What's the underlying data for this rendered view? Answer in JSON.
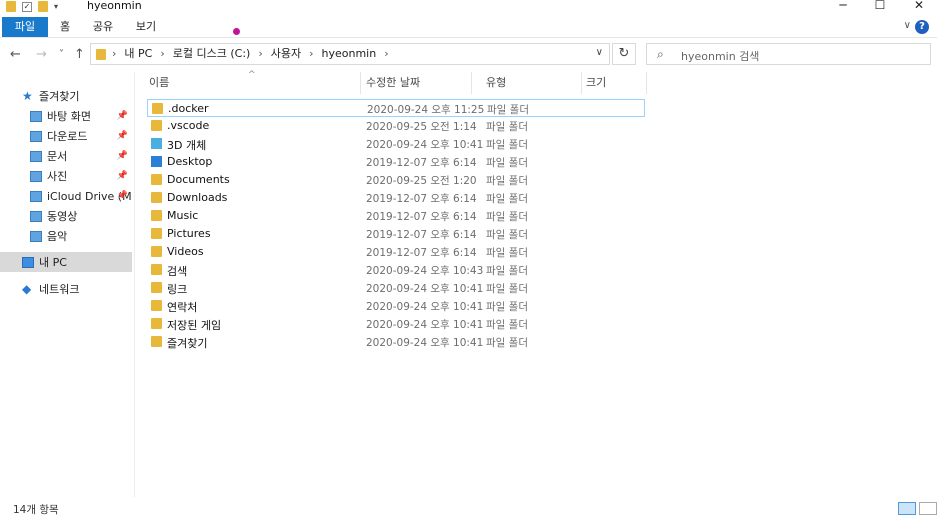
{
  "window": {
    "title": "hyeonmin",
    "buttons": [
      "─",
      "☐",
      "✕"
    ]
  },
  "ribbon": {
    "tabs": [
      "파일",
      "홈",
      "공유",
      "보기"
    ],
    "help": "?",
    "collapse": "∨"
  },
  "nav": {
    "back": "←",
    "forward": "→",
    "recent": "˅",
    "up": "↑"
  },
  "address": {
    "crumbs": [
      "내 PC",
      "로컬 디스크 (C:)",
      "사용자",
      "hyeonmin"
    ],
    "separator": "›",
    "dropdown": "∨"
  },
  "refresh": "↻",
  "search": {
    "placeholder": "hyeonmin 검색",
    "icon": "search-icon"
  },
  "sidebar": {
    "quick_access": "즐겨찾기",
    "items": [
      {
        "label": "바탕 화면",
        "pinned": true
      },
      {
        "label": "다운로드",
        "pinned": true
      },
      {
        "label": "문서",
        "pinned": true
      },
      {
        "label": "사진",
        "pinned": true
      },
      {
        "label": "iCloud Drive (M",
        "pinned": true
      },
      {
        "label": "동영상",
        "pinned": false
      },
      {
        "label": "음악",
        "pinned": false
      }
    ],
    "pc": "내 PC",
    "network": "네트워크"
  },
  "columns": [
    "이름",
    "수정한 날짜",
    "유형",
    "크기"
  ],
  "files": [
    {
      "name": ".docker",
      "date": "2020-09-24 오후 11:25",
      "type": "파일 폴더",
      "icon": "folder"
    },
    {
      "name": ".vscode",
      "date": "2020-09-25 오전 1:14",
      "type": "파일 폴더",
      "icon": "folder"
    },
    {
      "name": "3D 개체",
      "date": "2020-09-24 오후 10:41",
      "type": "파일 폴더",
      "icon": "3d-objects"
    },
    {
      "name": "Desktop",
      "date": "2019-12-07 오후 6:14",
      "type": "파일 폴더",
      "icon": "desktop"
    },
    {
      "name": "Documents",
      "date": "2020-09-25 오전 1:20",
      "type": "파일 폴더",
      "icon": "folder"
    },
    {
      "name": "Downloads",
      "date": "2019-12-07 오후 6:14",
      "type": "파일 폴더",
      "icon": "folder"
    },
    {
      "name": "Music",
      "date": "2019-12-07 오후 6:14",
      "type": "파일 폴더",
      "icon": "folder"
    },
    {
      "name": "Pictures",
      "date": "2019-12-07 오후 6:14",
      "type": "파일 폴더",
      "icon": "folder"
    },
    {
      "name": "Videos",
      "date": "2019-12-07 오후 6:14",
      "type": "파일 폴더",
      "icon": "folder"
    },
    {
      "name": "검색",
      "date": "2020-09-24 오후 10:43",
      "type": "파일 폴더",
      "icon": "searches"
    },
    {
      "name": "링크",
      "date": "2020-09-24 오후 10:41",
      "type": "파일 폴더",
      "icon": "links"
    },
    {
      "name": "연락처",
      "date": "2020-09-24 오후 10:41",
      "type": "파일 폴더",
      "icon": "contacts"
    },
    {
      "name": "저장된 게임",
      "date": "2020-09-24 오후 10:41",
      "type": "파일 폴더",
      "icon": "saved-games"
    },
    {
      "name": "즐겨찾기",
      "date": "2020-09-24 오후 10:41",
      "type": "파일 폴더",
      "icon": "favorites"
    }
  ],
  "status": "14개 항목",
  "colors": {
    "accent": "#1979ca",
    "folder": "#e8b83a",
    "selection": "#99d1ff"
  }
}
